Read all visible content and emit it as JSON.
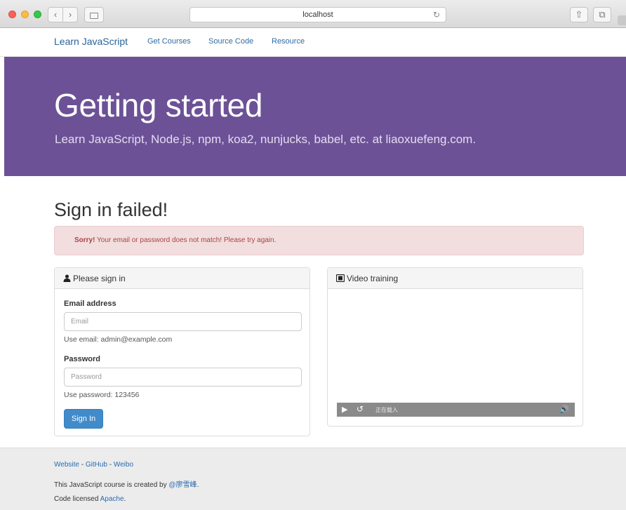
{
  "browser": {
    "url": "localhost",
    "back_icon": "chevron-left-icon",
    "forward_icon": "chevron-right-icon",
    "reload_icon": "reload-icon"
  },
  "nav": {
    "brand": "Learn JavaScript",
    "links": [
      "Get Courses",
      "Source Code",
      "Resource"
    ]
  },
  "hero": {
    "title": "Getting started",
    "subtitle": "Learn JavaScript, Node.js, npm, koa2, nunjucks, babel, etc. at liaoxuefeng.com.",
    "background": "#6c5197"
  },
  "main": {
    "title": "Sign in failed!",
    "alert": {
      "strong": "Sorry!",
      "message": " Your email or password does not match! Please try again."
    }
  },
  "signin_panel": {
    "heading": "Please sign in",
    "email_label": "Email address",
    "email_placeholder": "Email",
    "email_help": "Use email: admin@example.com",
    "password_label": "Password",
    "password_placeholder": "Password",
    "password_help": "Use password: 123456",
    "button": "Sign In",
    "button_color": "#428bca"
  },
  "video_panel": {
    "heading": "Video training",
    "status": "正在载入"
  },
  "footer": {
    "links": [
      "Website",
      "GitHub",
      "Weibo"
    ],
    "separator": " - ",
    "credit_prefix": "This JavaScript course is created by ",
    "credit_author": "@廖雪峰",
    "credit_suffix": ".",
    "license_prefix": "Code licensed ",
    "license_link": "Apache",
    "license_suffix": "."
  }
}
